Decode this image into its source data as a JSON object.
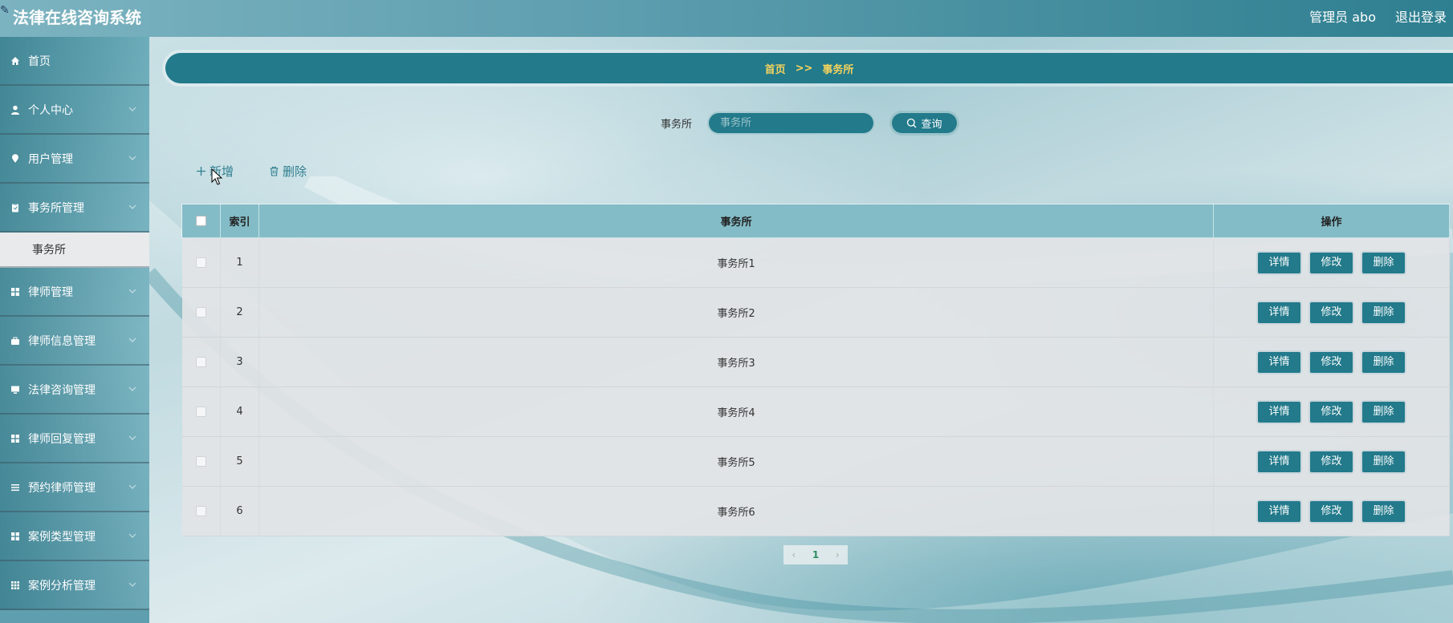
{
  "header": {
    "title": "法律在线咨询系统",
    "user": "管理员 abo",
    "logout": "退出登录"
  },
  "sidebar": {
    "items": [
      {
        "label": "首页",
        "icon": "home-icon"
      },
      {
        "label": "个人中心",
        "icon": "user-icon"
      },
      {
        "label": "用户管理",
        "icon": "location-pin-icon"
      },
      {
        "label": "事务所管理",
        "icon": "clipboard-icon"
      },
      {
        "label": "律师管理",
        "icon": "grid-icon"
      },
      {
        "label": "律师信息管理",
        "icon": "briefcase-icon"
      },
      {
        "label": "法律咨询管理",
        "icon": "monitor-icon"
      },
      {
        "label": "律师回复管理",
        "icon": "grid-icon"
      },
      {
        "label": "预约律师管理",
        "icon": "list-icon"
      },
      {
        "label": "案例类型管理",
        "icon": "grid-icon"
      },
      {
        "label": "案例分析管理",
        "icon": "grid-nine-icon"
      }
    ],
    "submenu_label": "事务所"
  },
  "breadcrumb": {
    "home": "首页",
    "separator": ">>",
    "current": "事务所"
  },
  "search": {
    "label": "事务所",
    "placeholder": "事务所",
    "button": "查询"
  },
  "actions": {
    "add": "新增",
    "delete": "删除"
  },
  "table": {
    "headers": {
      "index": "索引",
      "name": "事务所",
      "ops": "操作"
    },
    "rows": [
      {
        "index": "1",
        "name": "事务所1"
      },
      {
        "index": "2",
        "name": "事务所2"
      },
      {
        "index": "3",
        "name": "事务所3"
      },
      {
        "index": "4",
        "name": "事务所4"
      },
      {
        "index": "5",
        "name": "事务所5"
      },
      {
        "index": "6",
        "name": "事务所6"
      }
    ],
    "op_labels": {
      "detail": "详情",
      "edit": "修改",
      "delete": "删除"
    }
  },
  "pagination": {
    "current": "1"
  },
  "colors": {
    "accent": "#227a8b",
    "breadcrumb_text": "#f4d35e"
  }
}
